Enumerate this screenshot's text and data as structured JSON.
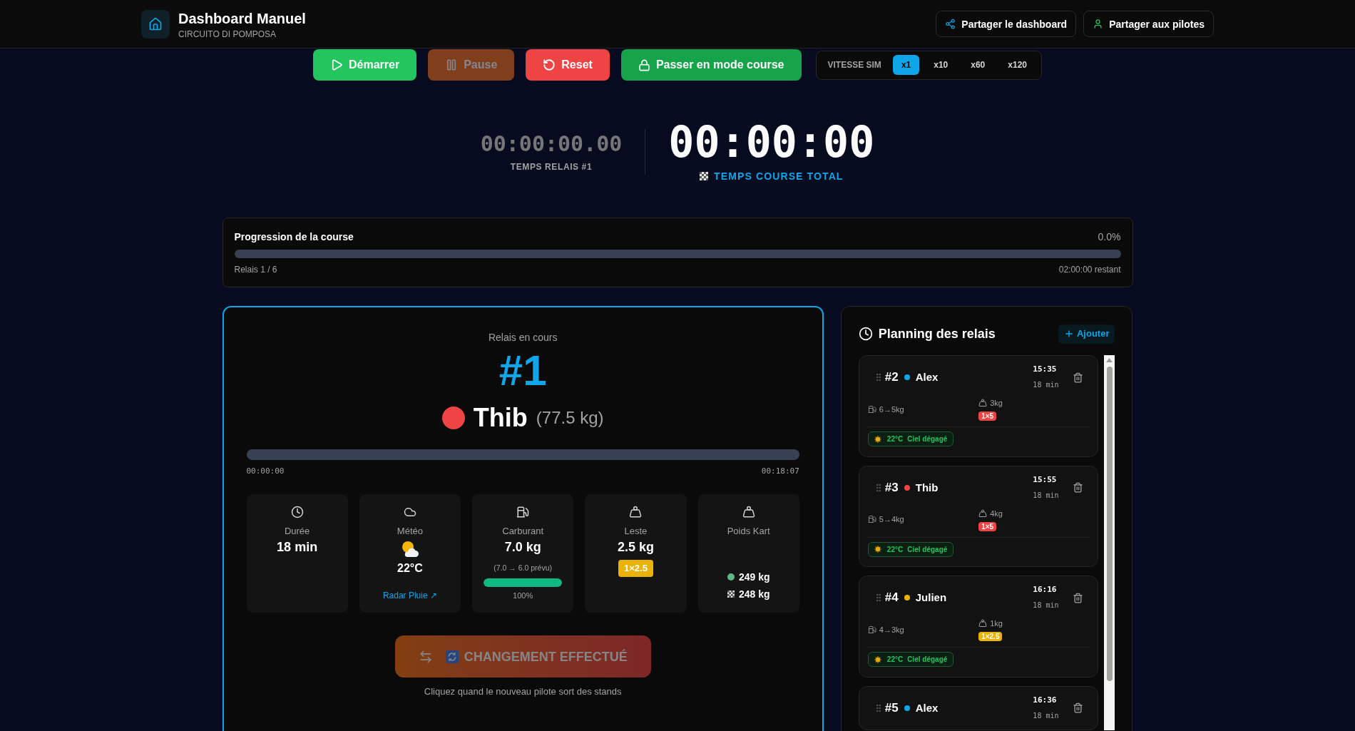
{
  "header": {
    "title": "Dashboard Manuel",
    "subtitle": "CIRCUITO DI POMPOSA",
    "actions": [
      {
        "label": "Partager le dashboard",
        "kind": "share"
      },
      {
        "label": "Partager aux pilotes",
        "kind": "pilots"
      }
    ]
  },
  "controls": [
    {
      "label": "Démarrer",
      "kind": "start",
      "disabled": false
    },
    {
      "label": "Pause",
      "kind": "pause",
      "disabled": true
    },
    {
      "label": "Reset",
      "kind": "reset",
      "disabled": false
    },
    {
      "label": "Passer en mode course",
      "kind": "race_mode",
      "disabled": false
    }
  ],
  "sim_speed": {
    "label": "VITESSE SIM",
    "options": [
      {
        "label": "x1",
        "selected": true
      },
      {
        "label": "x10",
        "selected": false
      },
      {
        "label": "x60",
        "selected": false
      },
      {
        "label": "x120",
        "selected": false
      }
    ]
  },
  "timers": {
    "relay": {
      "value": "00:00:00.00",
      "label": "TEMPS RELAIS #1"
    },
    "total": {
      "value": "00:00:00",
      "label": "TEMPS COURSE TOTAL"
    }
  },
  "race_progress": {
    "title": "Progression de la course",
    "percent": "0.0%",
    "level": 0,
    "relay_count": "Relais 1 / 6",
    "remaining": "02:00:00 restant"
  },
  "current_relay": {
    "caption": "Relais en cours",
    "number": "#1",
    "driver": "Thib",
    "color": "#ef4444",
    "driver_weight": "(77.5 kg)",
    "level": 0,
    "start": "00:00:00",
    "end": "00:18:07",
    "stats": [
      {
        "kind": "duration",
        "label": "Durée",
        "value": "18 min"
      },
      {
        "kind": "weather",
        "label": "Météo",
        "value": "22°C",
        "link": "Radar Pluie ↗"
      },
      {
        "kind": "fuel",
        "label": "Carburant",
        "value": "7.0 kg",
        "note": "(7.0 → 6.0 prévu)",
        "level": 1,
        "reading": "100%"
      },
      {
        "kind": "ballast",
        "label": "Leste",
        "value": "2.5 kg",
        "badge": "1×2.5",
        "color": "#eab308"
      },
      {
        "kind": "kart_weight",
        "label": "Poids Kart",
        "rows": [
          {
            "kind": "current",
            "value": "249 kg"
          },
          {
            "kind": "finish",
            "value": "248 kg"
          }
        ]
      }
    ],
    "action": {
      "label": "CHANGEMENT EFFECTUÉ",
      "disabled": true
    },
    "hint": "Cliquez quand le nouveau pilote sort des stands"
  },
  "planning": {
    "title": "Planning des relais",
    "add_label": "Ajouter",
    "relays": [
      {
        "number": "#2",
        "driver": "Alex",
        "color": "#0ea5e9",
        "time": "15:35",
        "duration": "18 min",
        "fuel": "6→5kg",
        "ballast": "3kg",
        "ballast_badge": {
          "label": "1×5",
          "color": "#ef4444"
        },
        "weather": {
          "temp": "22°C",
          "sky": "Ciel dégagé"
        }
      },
      {
        "number": "#3",
        "driver": "Thib",
        "color": "#ef4444",
        "time": "15:55",
        "duration": "18 min",
        "fuel": "5→4kg",
        "ballast": "4kg",
        "ballast_badge": {
          "label": "1×5",
          "color": "#ef4444"
        },
        "weather": {
          "temp": "22°C",
          "sky": "Ciel dégagé"
        }
      },
      {
        "number": "#4",
        "driver": "Julien",
        "color": "#eab308",
        "time": "16:16",
        "duration": "18 min",
        "fuel": "4→3kg",
        "ballast": "1kg",
        "ballast_badge": {
          "label": "1×2.5",
          "color": "#eab308"
        },
        "weather": {
          "temp": "22°C",
          "sky": "Ciel dégagé"
        }
      },
      {
        "number": "#5",
        "driver": "Alex",
        "color": "#0ea5e9",
        "time": "16:36",
        "duration": "18 min"
      }
    ]
  }
}
